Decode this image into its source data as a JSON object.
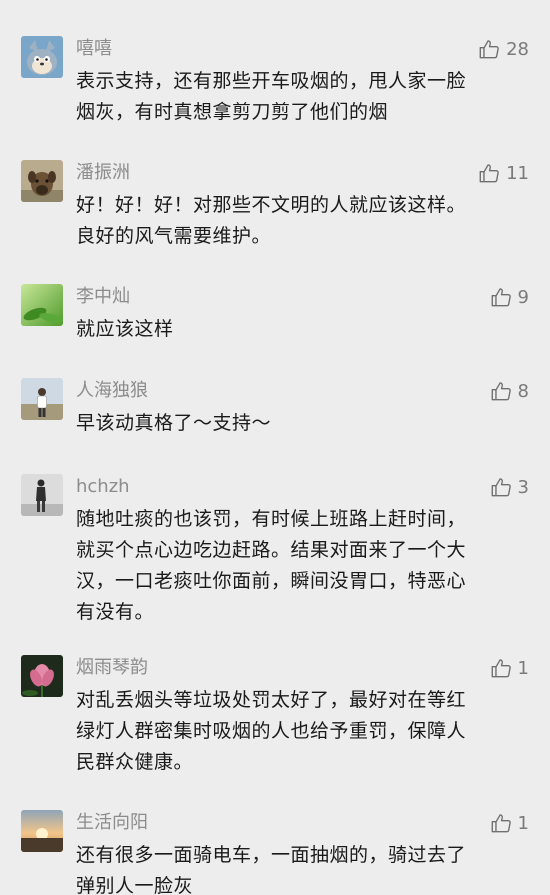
{
  "comments": [
    {
      "name": "嘻嘻",
      "likes": "28",
      "lines": [
        "表示支持，还有那些开车吸烟的，甩人家一脸",
        "烟灰，有时真想拿剪刀剪了他们的烟"
      ],
      "avatar_icon": "cartoon-cat-avatar-icon"
    },
    {
      "name": "潘振洲",
      "likes": "11",
      "lines": [
        "好！好！好！对那些不文明的人就应该这样。",
        "良好的风气需要维护。"
      ],
      "avatar_icon": "puppy-avatar-icon"
    },
    {
      "name": "李中灿",
      "likes": "9",
      "lines": [
        "就应该这样"
      ],
      "avatar_icon": "green-leaf-avatar-icon"
    },
    {
      "name": "人海独狼",
      "likes": "8",
      "lines": [
        "早该动真格了～支持～"
      ],
      "avatar_icon": "person-outdoor-avatar-icon"
    },
    {
      "name": "hchzh",
      "likes": "3",
      "lines": [
        "随地吐痰的也该罚，有时候上班路上赶时间，",
        "就买个点心边吃边赶路。结果对面来了一个大",
        "汉，一口老痰吐你面前，瞬间没胃口，特恶心",
        "有没有。"
      ],
      "avatar_icon": "walking-figure-avatar-icon"
    },
    {
      "name": "烟雨琴韵",
      "likes": "1",
      "lines": [
        "对乱丢烟头等垃圾处罚太好了，最好对在等红",
        "绿灯人群密集时吸烟的人也给予重罚，保障人",
        "民群众健康。"
      ],
      "avatar_icon": "lotus-flower-avatar-icon"
    },
    {
      "name": "生活向阳",
      "likes": "1",
      "lines": [
        "还有很多一面骑电车，一面抽烟的，骑过去了",
        "弹别人一脸灰"
      ],
      "avatar_icon": "sunset-avatar-icon"
    }
  ],
  "colors": {
    "background": "#ededed",
    "name": "#8c8c8c",
    "text": "#1a1a1a",
    "like": "#7a7a7a"
  },
  "like_icon": "thumbs-up-icon"
}
